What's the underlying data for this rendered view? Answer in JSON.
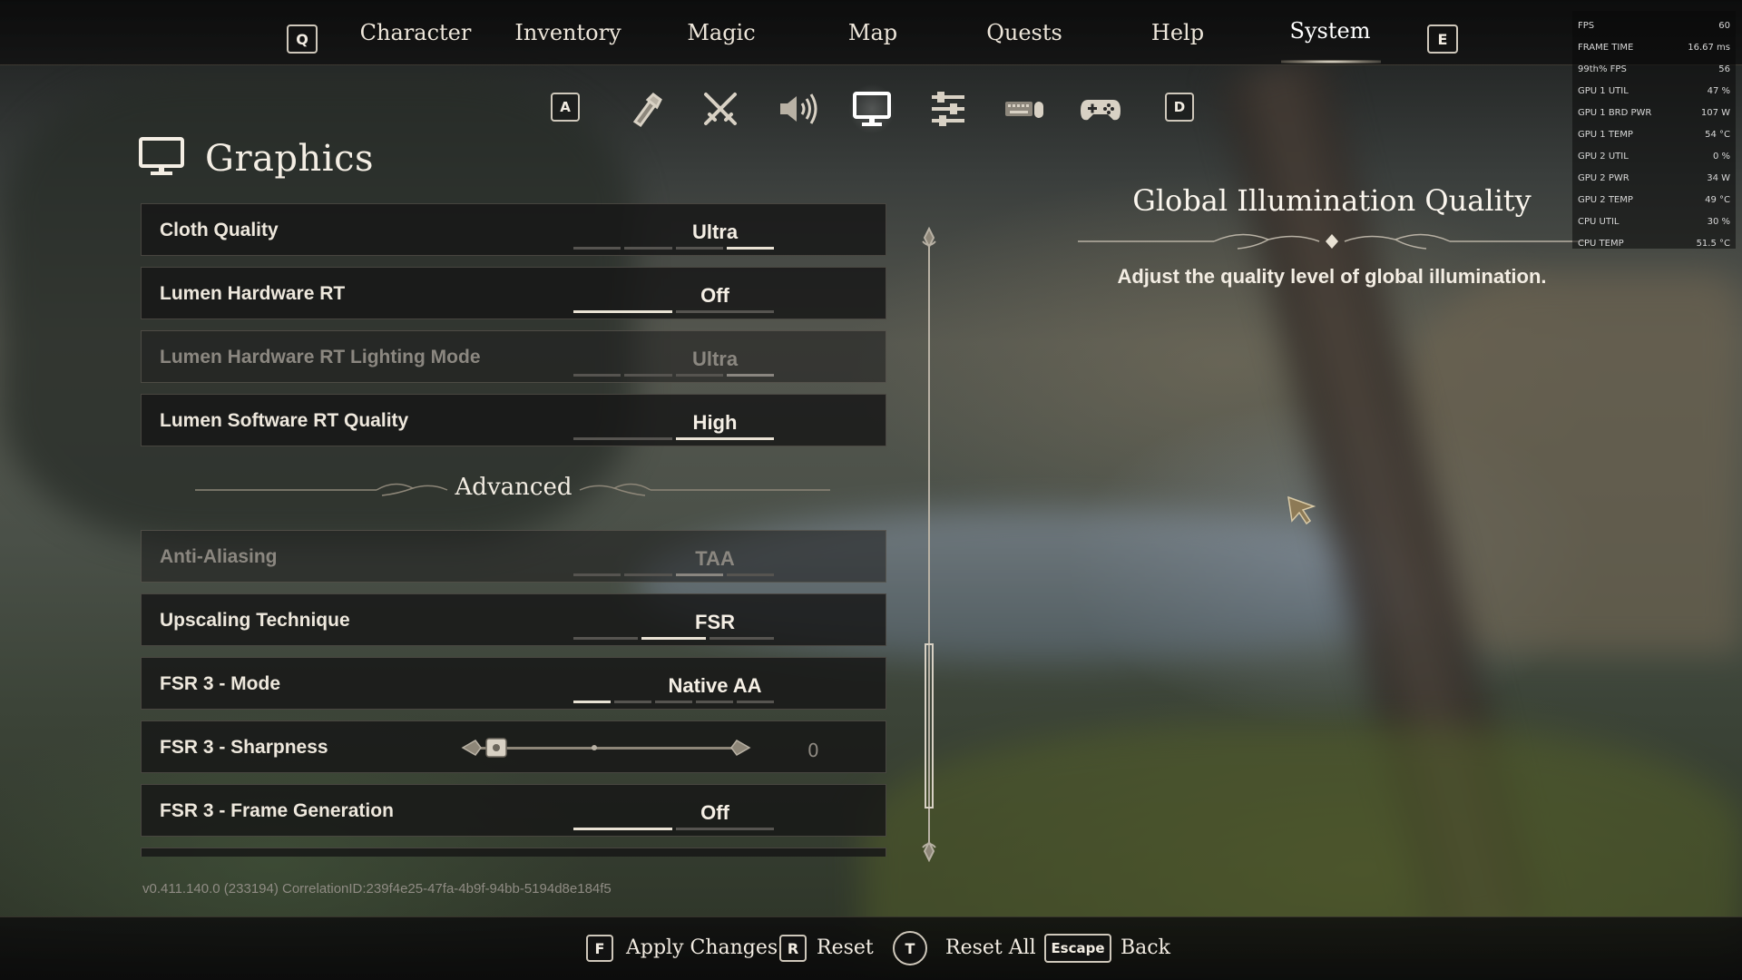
{
  "nav": {
    "prev_key": "Q",
    "next_key": "E",
    "tabs": [
      "Character",
      "Inventory",
      "Magic",
      "Map",
      "Quests",
      "Help",
      "System"
    ],
    "active_tab": "System"
  },
  "subnav": {
    "prev_key": "A",
    "next_key": "D",
    "icons": [
      "flashlight-icon",
      "crossed-swords-icon",
      "speaker-icon",
      "monitor-icon",
      "sliders-icon",
      "keyboard-mouse-icon",
      "gamepad-icon"
    ],
    "active_icon": "monitor-icon"
  },
  "page": {
    "title": "Graphics"
  },
  "settings": [
    {
      "label": "Cloth Quality",
      "value": "Ultra",
      "segments": 4,
      "selected": 3,
      "disabled": false
    },
    {
      "label": "Lumen Hardware RT",
      "value": "Off",
      "segments": 2,
      "selected": 0,
      "disabled": false
    },
    {
      "label": "Lumen Hardware RT Lighting Mode",
      "value": "Ultra",
      "segments": 4,
      "selected": 3,
      "disabled": true
    },
    {
      "label": "Lumen Software RT Quality",
      "value": "High",
      "segments": 2,
      "selected": 1,
      "disabled": false
    }
  ],
  "advanced": {
    "title": "Advanced",
    "settings": [
      {
        "label": "Anti-Aliasing",
        "value": "TAA",
        "segments": 4,
        "selected": 2,
        "disabled": true
      },
      {
        "label": "Upscaling Technique",
        "value": "FSR",
        "segments": 3,
        "selected": 1,
        "disabled": false
      },
      {
        "label": "FSR 3 - Mode",
        "value": "Native AA",
        "segments": 5,
        "selected": 0,
        "disabled": false
      },
      {
        "label": "FSR 3 - Sharpness",
        "value": "0",
        "type": "slider",
        "level": 0
      },
      {
        "label": "FSR 3 - Frame Generation",
        "value": "Off",
        "segments": 2,
        "selected": 0,
        "disabled": false
      }
    ]
  },
  "description": {
    "title": "Global Illumination Quality",
    "text": "Adjust the quality level of global illumination."
  },
  "perf": [
    {
      "label": "FPS",
      "value": "60"
    },
    {
      "label": "FRAME TIME",
      "value": "16.67 ms"
    },
    {
      "label": "99th% FPS",
      "value": "56"
    },
    {
      "label": "GPU 1 UTIL",
      "value": "47 %"
    },
    {
      "label": "GPU 1 BRD PWR",
      "value": "107 W"
    },
    {
      "label": "GPU 1 TEMP",
      "value": "54 °C"
    },
    {
      "label": "GPU 2 UTIL",
      "value": "0 %"
    },
    {
      "label": "GPU 2 PWR",
      "value": "34 W"
    },
    {
      "label": "GPU 2 TEMP",
      "value": "49 °C"
    },
    {
      "label": "CPU UTIL",
      "value": "30 %"
    },
    {
      "label": "CPU TEMP",
      "value": "51.5 °C"
    }
  ],
  "version": "v0.411.140.0 (233194) CorrelationID:239f4e25-47fa-4b9f-94bb-5194d8e184f5",
  "actions": [
    {
      "key": "F",
      "label": "Apply Changes"
    },
    {
      "key": "R",
      "label": "Reset"
    },
    {
      "key": "T",
      "label": "Reset All"
    },
    {
      "key": "Escape",
      "label": "Back"
    }
  ],
  "colors": {
    "accent": "#e9e2d4",
    "panel": "#161616",
    "disabled_text": "#8b8780"
  }
}
